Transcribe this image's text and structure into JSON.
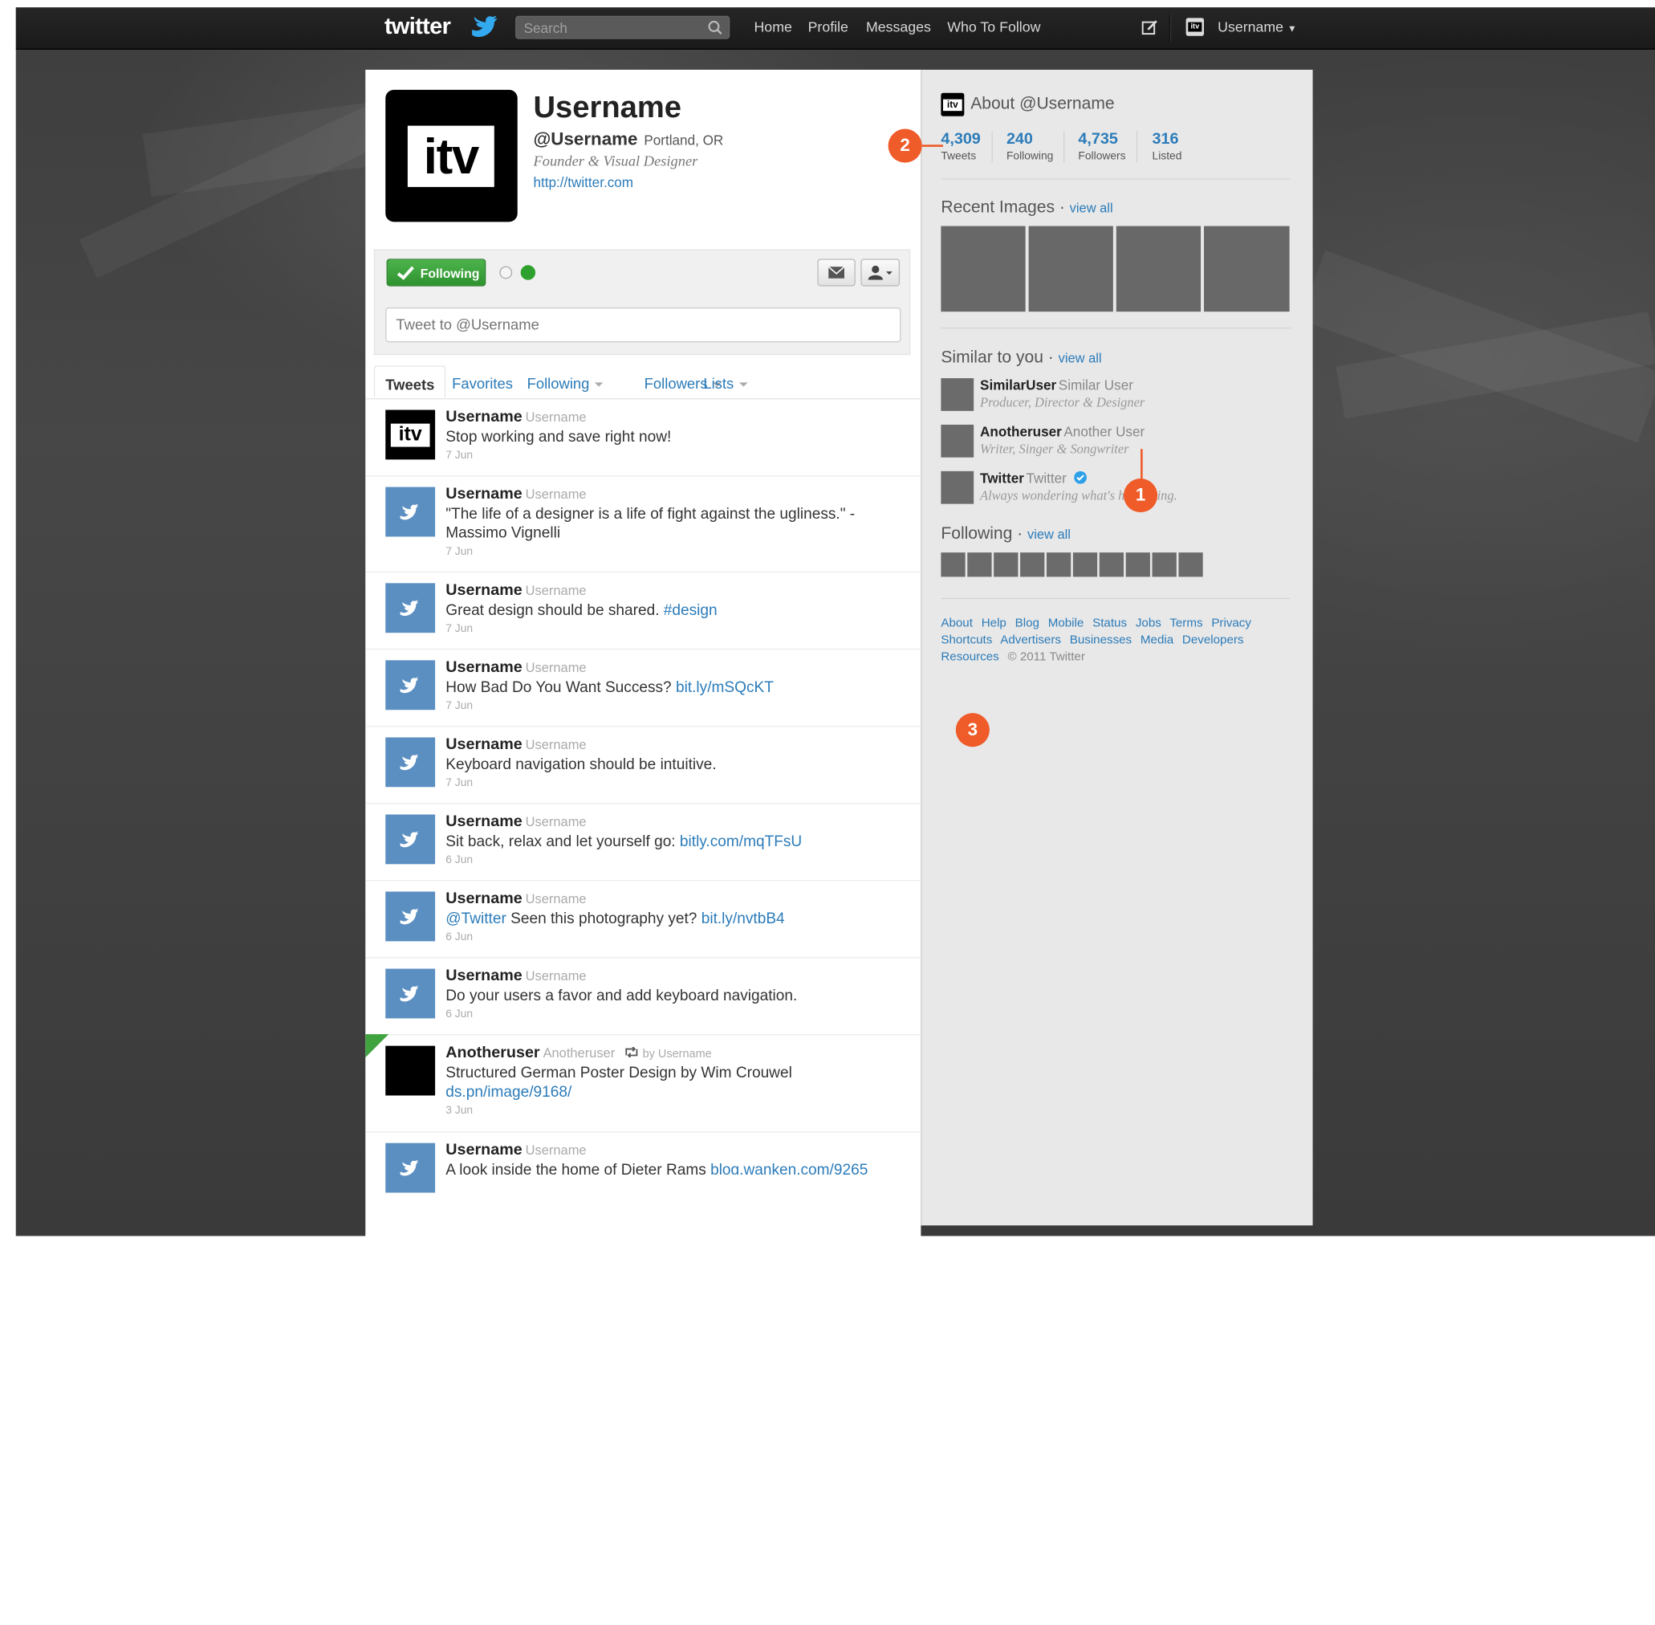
{
  "topbar": {
    "logo": "twitter",
    "search_placeholder": "Search",
    "nav": [
      "Home",
      "Profile",
      "Messages",
      "Who To Follow"
    ],
    "account_name": "Username",
    "account_avatar": "itv"
  },
  "profile": {
    "avatar_text": "itv",
    "name": "Username",
    "handle": "@Username",
    "location": "Portland, OR",
    "bio": "Founder & Visual Designer",
    "url": "http://twitter.com"
  },
  "actions": {
    "following_label": "Following",
    "tweet_placeholder": "Tweet to @Username"
  },
  "tabs": [
    "Tweets",
    "Favorites",
    "Following",
    "Followers",
    "Lists"
  ],
  "tweets": [
    {
      "author": "Username",
      "screen": "Username",
      "parts": [
        {
          "t": "Stop working and save right now!"
        }
      ],
      "date": "7 Jun",
      "avatar": "itv"
    },
    {
      "author": "Username",
      "screen": "Username",
      "parts": [
        {
          "t": "\"The life of a designer is a life of fight against the ugliness.\" - Massimo Vignelli"
        }
      ],
      "date": "7 Jun",
      "avatar": "bird"
    },
    {
      "author": "Username",
      "screen": "Username",
      "parts": [
        {
          "t": "Great design should be shared. "
        },
        {
          "t": "#design",
          "link": true
        }
      ],
      "date": "7 Jun",
      "avatar": "bird"
    },
    {
      "author": "Username",
      "screen": "Username",
      "parts": [
        {
          "t": "How Bad Do You Want Success? "
        },
        {
          "t": "bit.ly/mSQcKT",
          "link": true
        }
      ],
      "date": "7 Jun",
      "avatar": "bird"
    },
    {
      "author": "Username",
      "screen": "Username",
      "parts": [
        {
          "t": "Keyboard navigation should be intuitive."
        }
      ],
      "date": "7 Jun",
      "avatar": "bird"
    },
    {
      "author": "Username",
      "screen": "Username",
      "parts": [
        {
          "t": "Sit back, relax and let yourself go: "
        },
        {
          "t": "bitly.com/mqTFsU",
          "link": true
        }
      ],
      "date": "6 Jun",
      "avatar": "bird"
    },
    {
      "author": "Username",
      "screen": "Username",
      "parts": [
        {
          "t": "@Twitter",
          "link": true
        },
        {
          "t": " Seen this photography yet? "
        },
        {
          "t": "bit.ly/nvtbB4",
          "link": true
        }
      ],
      "date": "6 Jun",
      "avatar": "bird"
    },
    {
      "author": "Username",
      "screen": "Username",
      "parts": [
        {
          "t": "Do your users a favor and add keyboard navigation."
        }
      ],
      "date": "6 Jun",
      "avatar": "bird"
    },
    {
      "author": "Anotheruser",
      "screen": "Anotheruser",
      "retweet_by": "by Username",
      "parts": [
        {
          "t": "Structured German Poster Design by Wim Crouwel "
        },
        {
          "t": "ds.pn/image/9168/",
          "link": true
        }
      ],
      "date": "3 Jun",
      "avatar": "black"
    },
    {
      "author": "Username",
      "screen": "Username",
      "parts": [
        {
          "t": "A look inside the home of Dieter Rams "
        },
        {
          "t": "blog.wanken.com/9265",
          "link": true
        }
      ],
      "date": "",
      "avatar": "bird"
    }
  ],
  "sidebar": {
    "about_title": "About @Username",
    "stats": [
      {
        "value": "4,309",
        "label": "Tweets"
      },
      {
        "value": "240",
        "label": "Following"
      },
      {
        "value": "4,735",
        "label": "Followers"
      },
      {
        "value": "316",
        "label": "Listed"
      }
    ],
    "recent_images_title": "Recent Images",
    "similar_title": "Similar to you",
    "following_title": "Following",
    "view_all": "view all",
    "similar": [
      {
        "name": "SimilarUser",
        "sub": "Similar User",
        "bio": "Producer, Director & Designer",
        "verified": false
      },
      {
        "name": "Anotheruser",
        "sub": "Another User",
        "bio": "Writer, Singer & Songwriter",
        "verified": false
      },
      {
        "name": "Twitter",
        "sub": "Twitter",
        "bio": "Always wondering what's happening.",
        "verified": true
      }
    ],
    "footer_links": [
      "About",
      "Help",
      "Blog",
      "Mobile",
      "Status",
      "Jobs",
      "Terms",
      "Privacy",
      "Shortcuts",
      "Advertisers",
      "Businesses",
      "Media",
      "Developers",
      "Resources"
    ],
    "copyright": "© 2011 Twitter"
  },
  "callouts": [
    "1",
    "2",
    "3"
  ],
  "colors": {
    "link": "#2b7bb9",
    "follow_green": "#3fa33f",
    "callout": "#ef5b29",
    "topbar": "#1f1f1f"
  }
}
